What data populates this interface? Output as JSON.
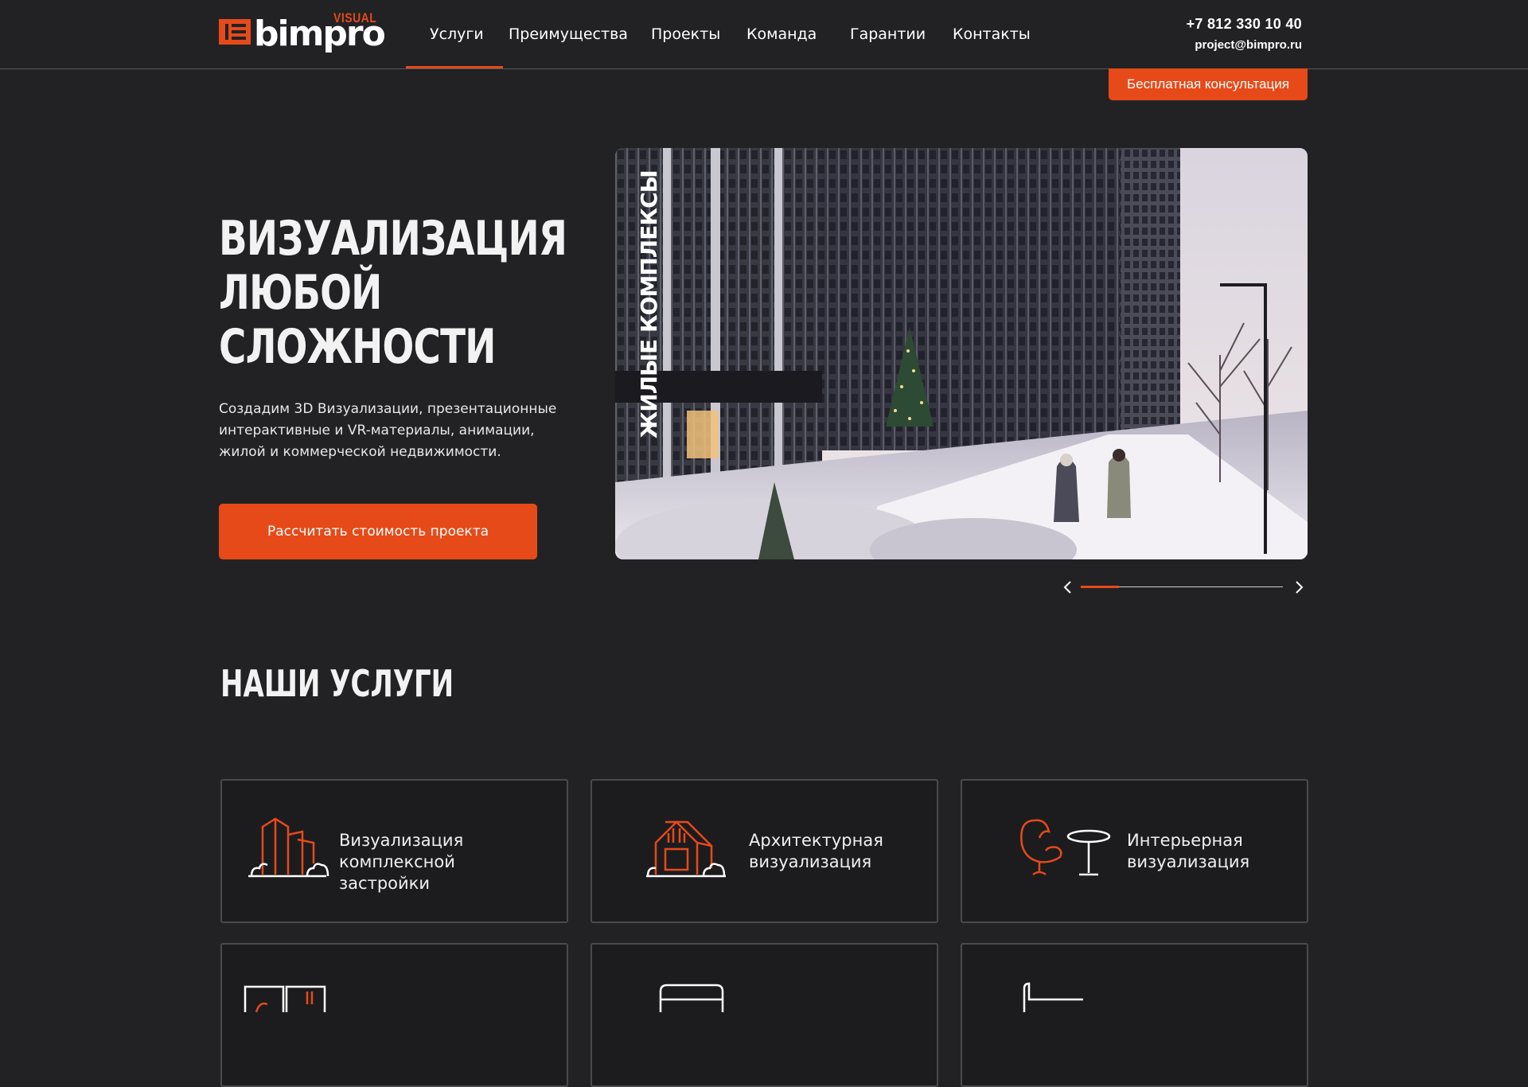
{
  "header": {
    "logo": {
      "text": "bimpro",
      "sub": "VISUAL"
    },
    "nav": [
      {
        "label": "Услуги",
        "active": true
      },
      {
        "label": "Преимущества"
      },
      {
        "label": "Проекты"
      },
      {
        "label": "Команда"
      },
      {
        "label": "Гарантии"
      },
      {
        "label": "Контакты"
      }
    ],
    "phone": "+7 812 330 10 40",
    "email": "project@bimpro.ru",
    "consult_button": "Бесплатная консультация"
  },
  "hero": {
    "title": [
      "Визуализация",
      "любой",
      "сложности"
    ],
    "description": "Создадим 3D Визуализации, презентационные интерактивные и VR-материалы, анимации, жилой и коммерческой недвижимости.",
    "cta": "Рассчитать стоимость проекта",
    "slide_caption": "ЖИЛЫЕ КОМПЛЕКСЫ",
    "slider_progress": 0.19
  },
  "services": {
    "title": "Наши услуги",
    "cards": [
      {
        "label": "Визуализация комплексной застройки",
        "icon": "residential-buildings-icon"
      },
      {
        "label": "Архитектурная визуализация",
        "icon": "house-icon"
      },
      {
        "label": "Интерьерная визуализация",
        "icon": "armchair-table-icon"
      },
      {
        "label": "",
        "icon": "book-icon"
      },
      {
        "label": "",
        "icon": "device-icon"
      },
      {
        "label": "",
        "icon": "tool-icon"
      }
    ]
  },
  "colors": {
    "accent": "#e64a19",
    "background": "#222225",
    "card": "#1c1c1e",
    "border": "#4a4a4e"
  }
}
